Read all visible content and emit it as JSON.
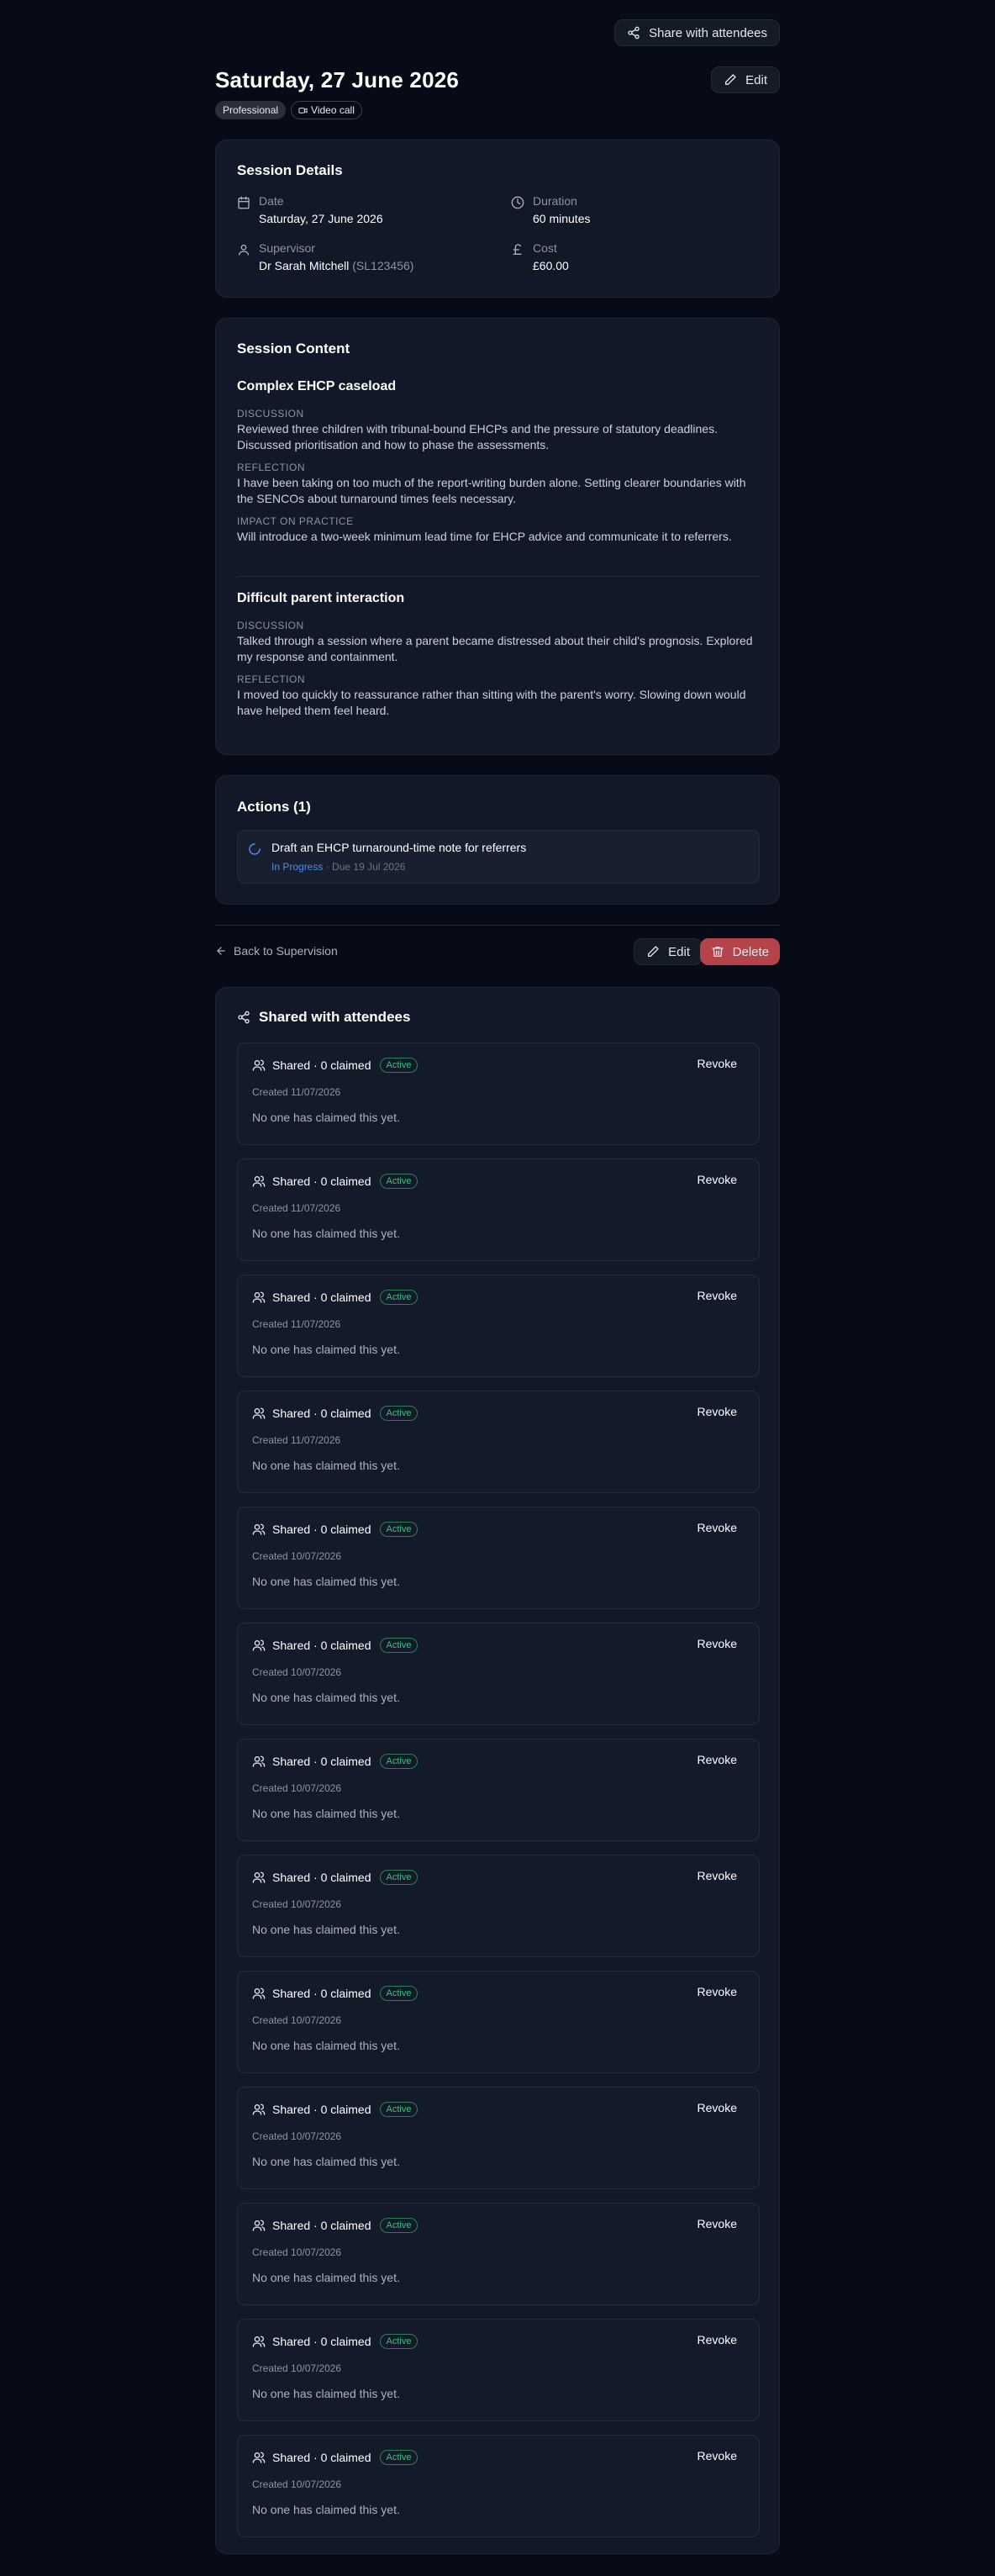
{
  "toolbar": {
    "share_label": "Share with attendees",
    "edit_label": "Edit"
  },
  "session": {
    "title": "Saturday, 27 June 2026",
    "tags": [
      "Professional",
      "Video call"
    ]
  },
  "details": {
    "heading": "Session Details",
    "date_label": "Date",
    "date_value": "Saturday, 27 June 2026",
    "duration_label": "Duration",
    "duration_value": "60 minutes",
    "supervisor_label": "Supervisor",
    "supervisor_value": "Dr Sarah Mitchell",
    "supervisor_id": "(SL123456)",
    "cost_label": "Cost",
    "cost_value": "£60.00"
  },
  "content": {
    "heading": "Session Content",
    "topics": [
      {
        "title": "Complex EHCP caseload",
        "sections": [
          {
            "label": "DISCUSSION",
            "text": "Reviewed three children with tribunal-bound EHCPs and the pressure of statutory deadlines. Discussed prioritisation and how to phase the assessments."
          },
          {
            "label": "REFLECTION",
            "text": "I have been taking on too much of the report-writing burden alone. Setting clearer boundaries with the SENCOs about turnaround times feels necessary."
          },
          {
            "label": "IMPACT ON PRACTICE",
            "text": "Will introduce a two-week minimum lead time for EHCP advice and communicate it to referrers."
          }
        ]
      },
      {
        "title": "Difficult parent interaction",
        "sections": [
          {
            "label": "DISCUSSION",
            "text": "Talked through a session where a parent became distressed about their child's prognosis. Explored my response and containment."
          },
          {
            "label": "REFLECTION",
            "text": "I moved too quickly to reassurance rather than sitting with the parent's worry. Slowing down would have helped them feel heard."
          }
        ]
      }
    ]
  },
  "actions": {
    "heading": "Actions (1)",
    "items": [
      {
        "title": "Draft an EHCP turnaround-time note for referrers",
        "status": "In Progress",
        "due": "Due 19 Jul 2026"
      }
    ]
  },
  "nav": {
    "back_label": "Back to Supervision",
    "edit_label": "Edit",
    "delete_label": "Delete"
  },
  "shared": {
    "heading": "Shared with attendees",
    "items": [
      {
        "title": "Shared · 0 claimed",
        "badge": "Active",
        "revoke": "Revoke",
        "created": "Created 11/07/2026",
        "empty": "No one has claimed this yet."
      },
      {
        "title": "Shared · 0 claimed",
        "badge": "Active",
        "revoke": "Revoke",
        "created": "Created 11/07/2026",
        "empty": "No one has claimed this yet."
      },
      {
        "title": "Shared · 0 claimed",
        "badge": "Active",
        "revoke": "Revoke",
        "created": "Created 11/07/2026",
        "empty": "No one has claimed this yet."
      },
      {
        "title": "Shared · 0 claimed",
        "badge": "Active",
        "revoke": "Revoke",
        "created": "Created 11/07/2026",
        "empty": "No one has claimed this yet."
      },
      {
        "title": "Shared · 0 claimed",
        "badge": "Active",
        "revoke": "Revoke",
        "created": "Created 10/07/2026",
        "empty": "No one has claimed this yet."
      },
      {
        "title": "Shared · 0 claimed",
        "badge": "Active",
        "revoke": "Revoke",
        "created": "Created 10/07/2026",
        "empty": "No one has claimed this yet."
      },
      {
        "title": "Shared · 0 claimed",
        "badge": "Active",
        "revoke": "Revoke",
        "created": "Created 10/07/2026",
        "empty": "No one has claimed this yet."
      },
      {
        "title": "Shared · 0 claimed",
        "badge": "Active",
        "revoke": "Revoke",
        "created": "Created 10/07/2026",
        "empty": "No one has claimed this yet."
      },
      {
        "title": "Shared · 0 claimed",
        "badge": "Active",
        "revoke": "Revoke",
        "created": "Created 10/07/2026",
        "empty": "No one has claimed this yet."
      },
      {
        "title": "Shared · 0 claimed",
        "badge": "Active",
        "revoke": "Revoke",
        "created": "Created 10/07/2026",
        "empty": "No one has claimed this yet."
      },
      {
        "title": "Shared · 0 claimed",
        "badge": "Active",
        "revoke": "Revoke",
        "created": "Created 10/07/2026",
        "empty": "No one has claimed this yet."
      },
      {
        "title": "Shared · 0 claimed",
        "badge": "Active",
        "revoke": "Revoke",
        "created": "Created 10/07/2026",
        "empty": "No one has claimed this yet."
      },
      {
        "title": "Shared · 0 claimed",
        "badge": "Active",
        "revoke": "Revoke",
        "created": "Created 10/07/2026",
        "empty": "No one has claimed this yet."
      }
    ]
  },
  "colors": {
    "background": "#070b17",
    "card": "#111827",
    "accent_blue": "#4d8bf0",
    "active_green": "#3fbf7f",
    "danger": "#b4434a"
  }
}
